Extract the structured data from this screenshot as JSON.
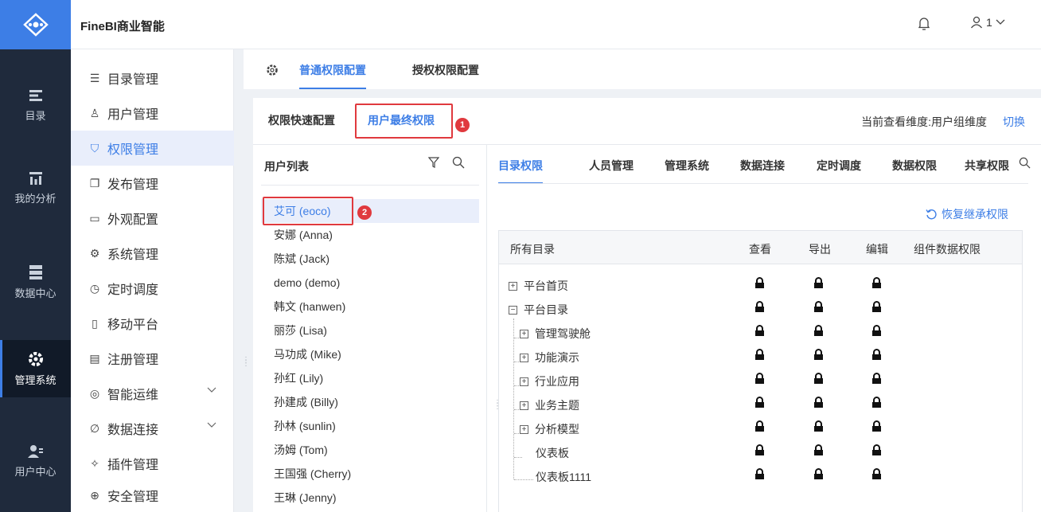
{
  "app": {
    "title": "FineBI商业智能",
    "user_count": "1"
  },
  "colors": {
    "accent": "#3d7ee6",
    "nav_bg": "#1f2a3c",
    "highlight": "#e0393e"
  },
  "leftnav": [
    {
      "label": "目录",
      "icon": "list-icon"
    },
    {
      "label": "我的分析",
      "icon": "chart-icon"
    },
    {
      "label": "数据中心",
      "icon": "database-icon"
    },
    {
      "label": "管理系统",
      "icon": "gear-icon",
      "active": true
    },
    {
      "label": "用户中心",
      "icon": "user-group-icon"
    }
  ],
  "submenu": [
    {
      "label": "目录管理",
      "icon": "directory-icon"
    },
    {
      "label": "用户管理",
      "icon": "user-icon"
    },
    {
      "label": "权限管理",
      "icon": "shield-icon",
      "active": true
    },
    {
      "label": "发布管理",
      "icon": "copy-icon"
    },
    {
      "label": "外观配置",
      "icon": "monitor-icon"
    },
    {
      "label": "系统管理",
      "icon": "gear-icon"
    },
    {
      "label": "定时调度",
      "icon": "timer-icon"
    },
    {
      "label": "移动平台",
      "icon": "mobile-icon"
    },
    {
      "label": "注册管理",
      "icon": "register-icon"
    },
    {
      "label": "智能运维",
      "icon": "ops-icon",
      "expandable": true
    },
    {
      "label": "数据连接",
      "icon": "link-icon",
      "expandable": true
    },
    {
      "label": "插件管理",
      "icon": "plugin-icon"
    },
    {
      "label": "安全管理",
      "icon": "security-icon"
    }
  ],
  "tabs": {
    "normal": "普通权限配置",
    "grant": "授权权限配置"
  },
  "subtabs": {
    "quick": "权限快速配置",
    "final": "用户最终权限"
  },
  "badges": {
    "one": "1",
    "two": "2"
  },
  "dimension": {
    "label": "当前查看维度:用户组维度",
    "switch": "切换"
  },
  "userlist": {
    "title": "用户列表",
    "users": [
      "艾可 (eoco)",
      "安娜 (Anna)",
      "陈斌 (Jack)",
      "demo (demo)",
      "韩文 (hanwen)",
      "丽莎 (Lisa)",
      "马功成 (Mike)",
      "孙红 (Lily)",
      "孙建成 (Billy)",
      "孙林 (sunlin)",
      "汤姆 (Tom)",
      "王国强 (Cherry)",
      "王琳 (Jenny)"
    ]
  },
  "ptabs": [
    "目录权限",
    "人员管理",
    "管理系统",
    "数据连接",
    "定时调度",
    "数据权限",
    "共享权限"
  ],
  "restore_label": "恢复继承权限",
  "table": {
    "headers": {
      "all": "所有目录",
      "view": "查看",
      "export": "导出",
      "edit": "编辑",
      "component": "组件数据权限"
    },
    "rows": [
      {
        "name": "平台首页",
        "toggle": "+"
      },
      {
        "name": "平台目录",
        "toggle": "−"
      },
      {
        "name": "管理驾驶舱",
        "toggle": "+"
      },
      {
        "name": "功能演示",
        "toggle": "+"
      },
      {
        "name": "行业应用",
        "toggle": "+"
      },
      {
        "name": "业务主题",
        "toggle": "+"
      },
      {
        "name": "分析模型",
        "toggle": "+"
      },
      {
        "name": "仪表板"
      },
      {
        "name": "仪表板1111"
      }
    ]
  }
}
